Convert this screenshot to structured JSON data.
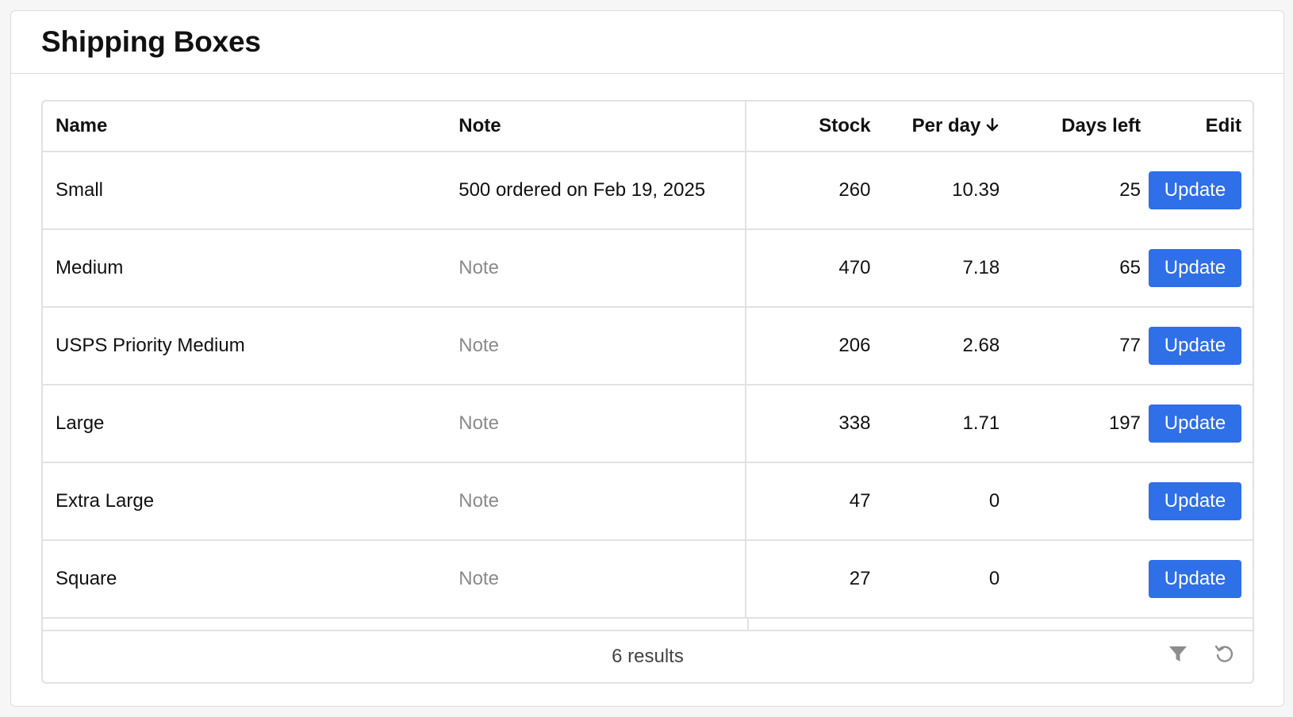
{
  "panel": {
    "title": "Shipping Boxes"
  },
  "table": {
    "columns": {
      "name": "Name",
      "note": "Note",
      "stock": "Stock",
      "per_day": "Per day",
      "days_left": "Days left",
      "edit": "Edit"
    },
    "sort": {
      "column": "per_day",
      "direction": "descending"
    },
    "rows": [
      {
        "name": "Small",
        "note": "500 ordered on Feb 19, 2025",
        "stock": "260",
        "per_day": "10.39",
        "days_left": "25",
        "action": "Update"
      },
      {
        "name": "Medium",
        "note": "",
        "stock": "470",
        "per_day": "7.18",
        "days_left": "65",
        "action": "Update"
      },
      {
        "name": "USPS Priority Medium",
        "note": "",
        "stock": "206",
        "per_day": "2.68",
        "days_left": "77",
        "action": "Update"
      },
      {
        "name": "Large",
        "note": "",
        "stock": "338",
        "per_day": "1.71",
        "days_left": "197",
        "action": "Update"
      },
      {
        "name": "Extra Large",
        "note": "",
        "stock": "47",
        "per_day": "0",
        "days_left": "",
        "action": "Update"
      },
      {
        "name": "Square",
        "note": "",
        "stock": "27",
        "per_day": "0",
        "days_left": "",
        "action": "Update"
      }
    ],
    "note_placeholder": "Note"
  },
  "footer": {
    "results": "6 results",
    "icons": [
      "filter-icon",
      "reset-icon"
    ]
  },
  "colors": {
    "accent": "#2f6fe8",
    "border": "#e2e2e2",
    "placeholder": "#8a8a8a"
  }
}
